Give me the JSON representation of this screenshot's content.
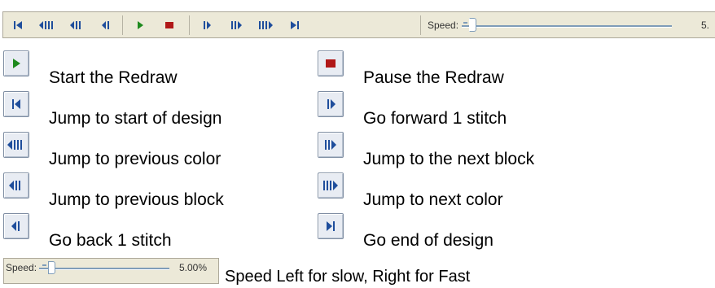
{
  "toolbar": {
    "buttons": [
      {
        "name": "jump-start-button",
        "icon": "skip-to-start-icon"
      },
      {
        "name": "prev-color-button",
        "icon": "previous-color-icon"
      },
      {
        "name": "prev-block-button",
        "icon": "previous-block-icon"
      },
      {
        "name": "back-stitch-button",
        "icon": "step-back-icon"
      },
      {
        "name": "start-redraw-button",
        "icon": "play-icon"
      },
      {
        "name": "pause-redraw-button",
        "icon": "stop-icon"
      },
      {
        "name": "forward-stitch-button",
        "icon": "step-forward-icon"
      },
      {
        "name": "next-block-button",
        "icon": "next-block-icon"
      },
      {
        "name": "next-color-button",
        "icon": "next-color-icon"
      },
      {
        "name": "jump-end-button",
        "icon": "skip-to-end-icon"
      }
    ],
    "speed_label": "Speed:",
    "speed_value": "5.",
    "speed_level_percent": 5
  },
  "legend": {
    "left": [
      {
        "icon": "play-icon",
        "text": "Start the Redraw"
      },
      {
        "icon": "skip-to-start-icon",
        "text": "Jump to start of design"
      },
      {
        "icon": "previous-color-icon",
        "text": "Jump to previous color"
      },
      {
        "icon": "previous-block-icon",
        "text": "Jump to previous block"
      },
      {
        "icon": "step-back-icon",
        "text": "Go back 1 stitch"
      }
    ],
    "right": [
      {
        "icon": "stop-icon",
        "text": "Pause the Redraw"
      },
      {
        "icon": "step-forward-icon",
        "text": "Go forward 1 stitch"
      },
      {
        "icon": "next-block-icon",
        "text": "Jump to the next block"
      },
      {
        "icon": "next-color-icon",
        "text": "Jump to next color"
      },
      {
        "icon": "skip-to-end-icon",
        "text": "Go end of design"
      }
    ]
  },
  "speed_panel": {
    "label": "Speed:",
    "value": "5.00%",
    "level_percent": 5,
    "description": "Speed Left for slow, Right for Fast"
  },
  "colors": {
    "toolbar_bg": "#ece9d8",
    "icon_blue": "#1f4e9c",
    "play_green": "#1e8a1e",
    "stop_red": "#b01818"
  }
}
